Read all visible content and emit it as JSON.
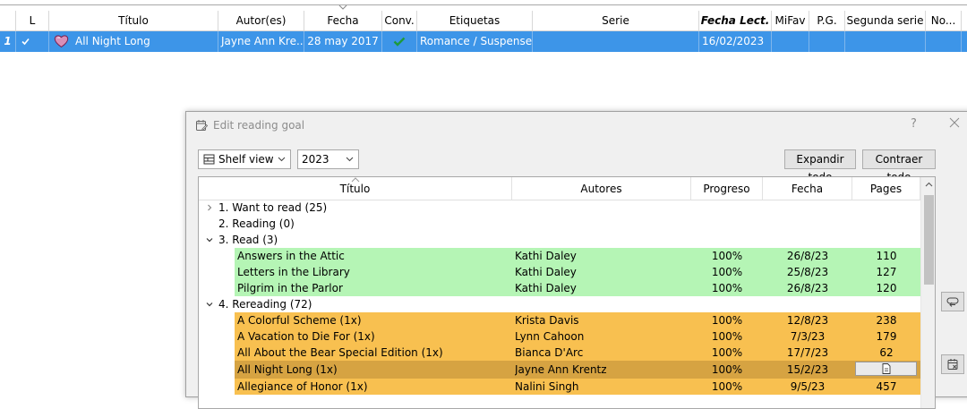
{
  "library": {
    "columns": {
      "l": "L",
      "titulo": "Título",
      "autor": "Autor(es)",
      "fecha": "Fecha",
      "conv": "Conv.",
      "etiquetas": "Etiquetas",
      "serie": "Serie",
      "fecha_lect": "Fecha Lect.",
      "mifav": "MiFav",
      "pg": "P.G.",
      "segunda_serie": "Segunda serie",
      "no": "No..."
    },
    "row": {
      "number": "1",
      "title": "All Night Long",
      "author": "Jayne Ann Kre...",
      "date": "28 may 2017",
      "tags": "Romance / Suspense",
      "read_date": "16/02/2023"
    },
    "colors": {
      "selected_row": "#3d95e8",
      "heart": "#c0408a",
      "check_green": "#1e9a3c"
    }
  },
  "dialog": {
    "title": "Edit reading goal",
    "help": "?",
    "view_select": "Shelf view",
    "year_select": "2023",
    "expand_all": "Expandir todo",
    "collapse_all": "Contraer todo",
    "columns": {
      "title": "Título",
      "authors": "Autores",
      "progress": "Progreso",
      "date": "Fecha",
      "pages": "Pages"
    },
    "colors": {
      "read_bg": "#b5f5b5",
      "reread_bg": "#f8c050",
      "reread_selected_bg": "#d6a342"
    },
    "groups": {
      "want": {
        "label": "1. Want to read (25)"
      },
      "reading": {
        "label": "2. Reading (0)"
      },
      "read": {
        "label": "3. Read (3)",
        "rows": [
          {
            "title": "Answers in the Attic",
            "author": "Kathi Daley",
            "progress": "100%",
            "date": "26/8/23",
            "pages": "110"
          },
          {
            "title": "Letters in the Library",
            "author": "Kathi Daley",
            "progress": "100%",
            "date": "25/8/23",
            "pages": "127"
          },
          {
            "title": "Pilgrim in the Parlor",
            "author": "Kathi Daley",
            "progress": "100%",
            "date": "26/8/23",
            "pages": "120"
          }
        ]
      },
      "rereading": {
        "label": "4. Rereading (72)",
        "rows": [
          {
            "title": "A Colorful Scheme (1x)",
            "author": "Krista Davis",
            "progress": "100%",
            "date": "12/8/23",
            "pages": "238"
          },
          {
            "title": "A Vacation to Die For (1x)",
            "author": "Lynn Cahoon",
            "progress": "100%",
            "date": "7/3/23",
            "pages": "179"
          },
          {
            "title": "All About the Bear Special Edition (1x)",
            "author": "Bianca D'Arc",
            "progress": "100%",
            "date": "17/7/23",
            "pages": "62"
          },
          {
            "title": "All Night Long (1x)",
            "author": "Jayne Ann Krentz",
            "progress": "100%",
            "date": "15/2/23",
            "pages": ""
          },
          {
            "title": "Allegiance of Honor (1x)",
            "author": "Nalini Singh",
            "progress": "100%",
            "date": "9/5/23",
            "pages": "457"
          }
        ]
      }
    }
  }
}
